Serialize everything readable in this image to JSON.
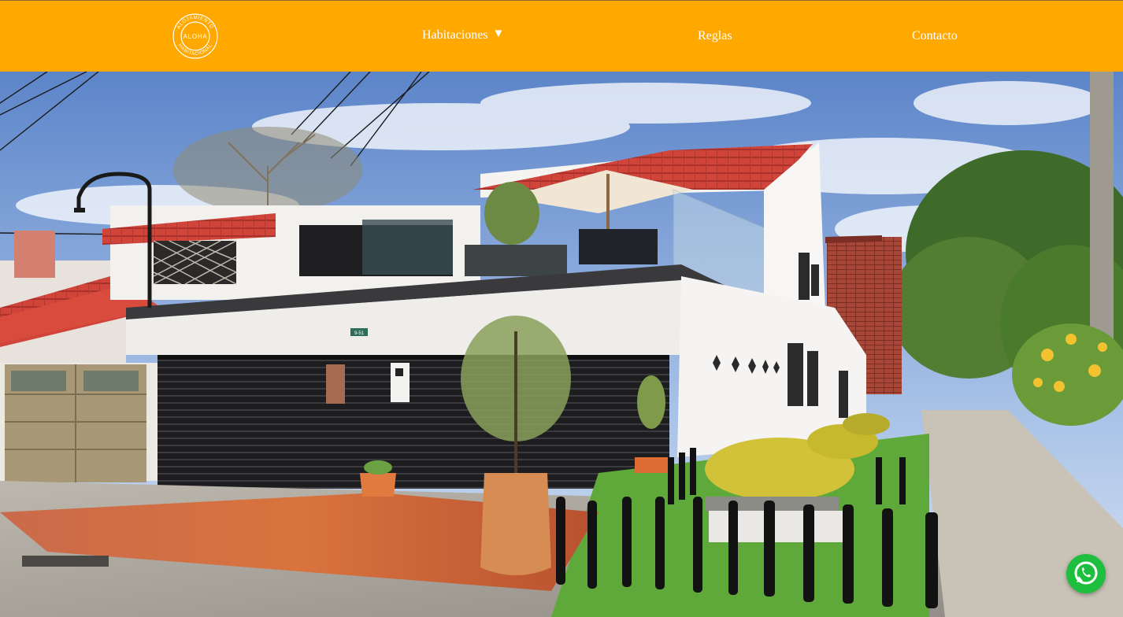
{
  "brand": {
    "logo_ring_text_top": "ALOJAMIENTO",
    "logo_ring_text_bottom": "HABITACIONAL",
    "logo_center_text": "ALOHA",
    "color": "#FFA800"
  },
  "nav": {
    "items": [
      {
        "label": "Habitaciones",
        "caret": "▼"
      },
      {
        "label": "Reglas"
      },
      {
        "label": "Contacto"
      }
    ]
  },
  "hero": {
    "house_number": "9-51"
  },
  "icons": {
    "logo": "aloha-logo-icon",
    "dropdown": "caret-down-icon",
    "chat": "whatsapp-icon"
  }
}
